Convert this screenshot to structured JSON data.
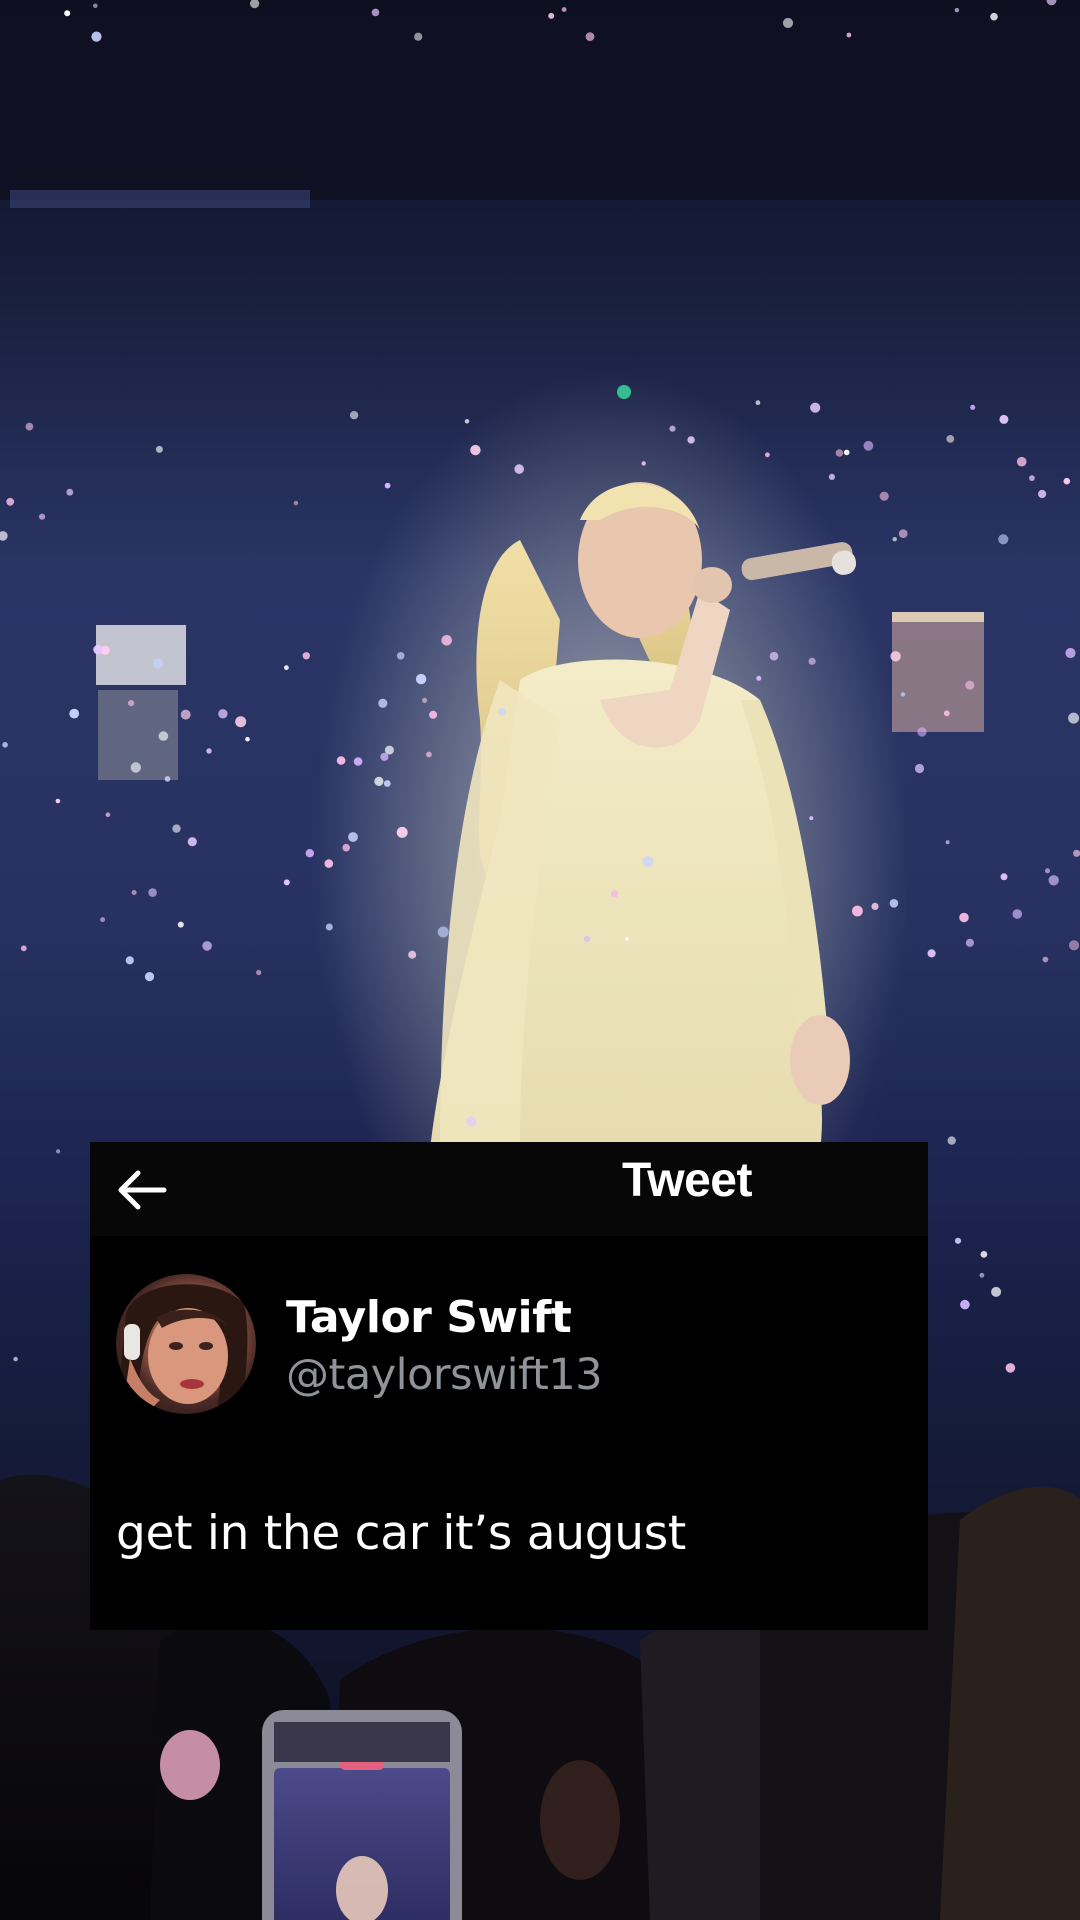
{
  "tweet": {
    "header_title": "Tweet",
    "author_name": "Taylor Swift",
    "author_handle": "@taylorswift13",
    "text": "get in the car it’s august"
  },
  "icons": {
    "back": "arrow-left-icon",
    "avatar": "avatar"
  },
  "colors": {
    "card_background": "#000000",
    "header_background": "#070707",
    "primary_text": "#ffffff",
    "secondary_text": "#8f9498"
  }
}
